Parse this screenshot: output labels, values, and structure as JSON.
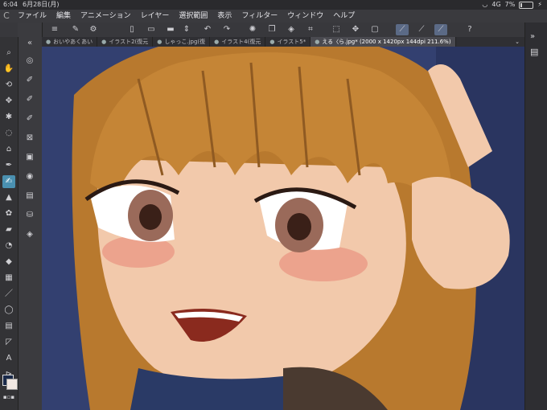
{
  "status": {
    "time": "6:04",
    "date": "6月28日(月)",
    "signal": "4G",
    "battery": "7%"
  },
  "menu": {
    "logo": "C",
    "items": [
      "ファイル",
      "編集",
      "アニメーション",
      "レイヤー",
      "選択範囲",
      "表示",
      "フィルター",
      "ウィンドウ",
      "ヘルプ"
    ]
  },
  "tabs": [
    {
      "label": "おいやあくあい",
      "active": false
    },
    {
      "label": "イラスト2(復元",
      "active": false
    },
    {
      "label": "しゃっこ.jpg(復",
      "active": false
    },
    {
      "label": "イラスト4(復元",
      "active": false
    },
    {
      "label": "イラスト5*",
      "active": false
    },
    {
      "label": "える〈ら.jpg* (2000 x 1420px 144dpi 211.6%)",
      "active": true
    }
  ],
  "colors": {
    "main": "#1a2a4a",
    "sub": "#f1e8e2",
    "canvas_bg": "#3d4a78"
  }
}
